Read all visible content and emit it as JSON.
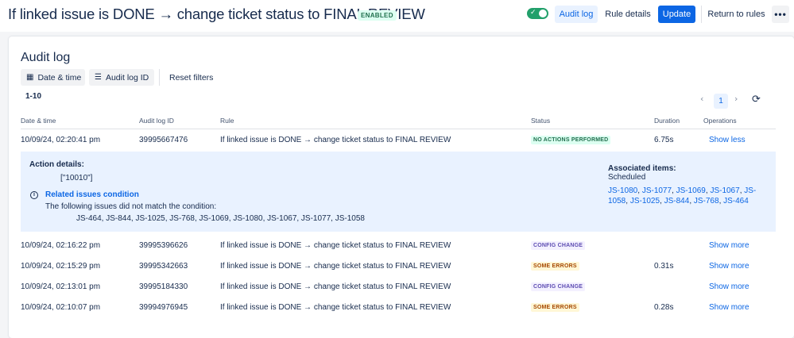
{
  "header": {
    "title": "If linked issue is DONE → change ticket status to FINAL REVIEW",
    "badge": "ENABLED",
    "toggle_on": true,
    "audit_log_label": "Audit log",
    "rule_details_label": "Rule details",
    "update_label": "Update",
    "return_label": "Return to rules",
    "more_label": "•••"
  },
  "card": {
    "title": "Audit log",
    "filters": {
      "date_label": "Date & time",
      "id_label": "Audit log ID",
      "reset_label": "Reset filters"
    },
    "range": "1-10",
    "pager": {
      "current": "1"
    },
    "columns": [
      "Date & time",
      "Audit log ID",
      "Rule",
      "Status",
      "Duration",
      "Operations"
    ]
  },
  "rows": [
    {
      "date": "10/09/24, 02:20:41 pm",
      "id": "39995667476",
      "rule": "If linked issue is DONE → change ticket status to FINAL REVIEW",
      "status": "NO ACTIONS PERFORMED",
      "duration": "6.75s",
      "op": "Show less"
    },
    {
      "date": "10/09/24, 02:16:22 pm",
      "id": "39995396626",
      "rule": "If linked issue is DONE → change ticket status to FINAL REVIEW",
      "status": "CONFIG CHANGE",
      "duration": "",
      "op": "Show more"
    },
    {
      "date": "10/09/24, 02:15:29 pm",
      "id": "39995342663",
      "rule": "If linked issue is DONE → change ticket status to FINAL REVIEW",
      "status": "SOME ERRORS",
      "duration": "0.31s",
      "op": "Show more"
    },
    {
      "date": "10/09/24, 02:13:01 pm",
      "id": "39995184330",
      "rule": "If linked issue is DONE → change ticket status to FINAL REVIEW",
      "status": "CONFIG CHANGE",
      "duration": "",
      "op": "Show more"
    },
    {
      "date": "10/09/24, 02:10:07 pm",
      "id": "39994976945",
      "rule": "If linked issue is DONE → change ticket status to FINAL REVIEW",
      "status": "SOME ERRORS",
      "duration": "0.28s",
      "op": "Show more"
    }
  ],
  "status_colors": {
    "NO ACTIONS PERFORMED": {
      "bg": "#dcfff1",
      "fg": "#216e4e"
    },
    "CONFIG CHANGE": {
      "bg": "#f3f0ff",
      "fg": "#5e4db2"
    },
    "SOME ERRORS": {
      "bg": "#fff7d6",
      "fg": "#a54800"
    }
  },
  "details": {
    "action_label": "Action details:",
    "action_value": "[\"10010\"]",
    "condition_title": "Related issues condition",
    "condition_text": "The following issues did not match the condition:",
    "condition_issues": "JS-464, JS-844, JS-1025, JS-768, JS-1069, JS-1080, JS-1067, JS-1077, JS-1058",
    "assoc_label": "Associated items:",
    "assoc_sub": "Scheduled",
    "assoc_issues": [
      "JS-1080",
      "JS-1077",
      "JS-1069",
      "JS-1067",
      "JS-1058",
      "JS-1025",
      "JS-844",
      "JS-768",
      "JS-464"
    ]
  }
}
